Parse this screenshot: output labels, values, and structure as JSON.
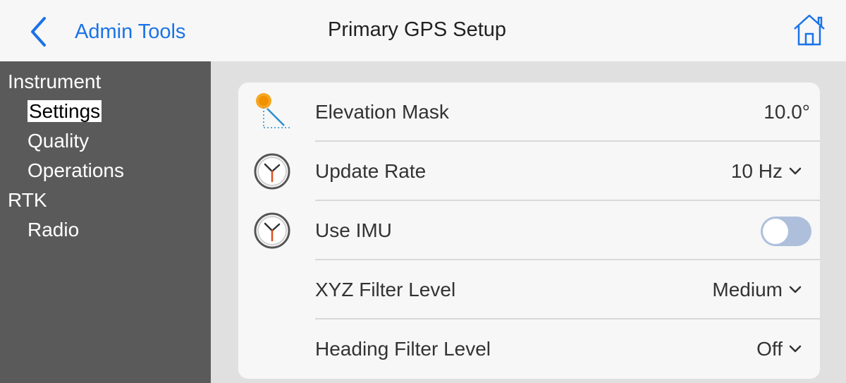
{
  "header": {
    "back_label": "Admin Tools",
    "title": "Primary GPS Setup",
    "back_icon": "chevron-left-icon",
    "home_icon": "home-icon"
  },
  "sidebar": {
    "items": [
      {
        "label": "Instrument",
        "level": 0
      },
      {
        "label": "Settings",
        "level": 1,
        "selected": true
      },
      {
        "label": "Quality",
        "level": 1
      },
      {
        "label": "Operations",
        "level": 1
      },
      {
        "label": "RTK",
        "level": 0
      },
      {
        "label": "Radio",
        "level": 1
      }
    ]
  },
  "settings": {
    "elevation_mask": {
      "label": "Elevation Mask",
      "value": "10.0°",
      "icon": "elevation-icon"
    },
    "update_rate": {
      "label": "Update Rate",
      "value": "10 Hz",
      "icon": "clock-icon"
    },
    "use_imu": {
      "label": "Use IMU",
      "enabled": false,
      "icon": "clock-icon"
    },
    "xyz_filter": {
      "label": "XYZ Filter Level",
      "value": "Medium"
    },
    "heading_filter": {
      "label": "Heading Filter Level",
      "value": "Off"
    }
  },
  "colors": {
    "accent": "#1a73e8",
    "sidebar_bg": "#5a5a5a",
    "toggle_off": "#aebfdb"
  }
}
